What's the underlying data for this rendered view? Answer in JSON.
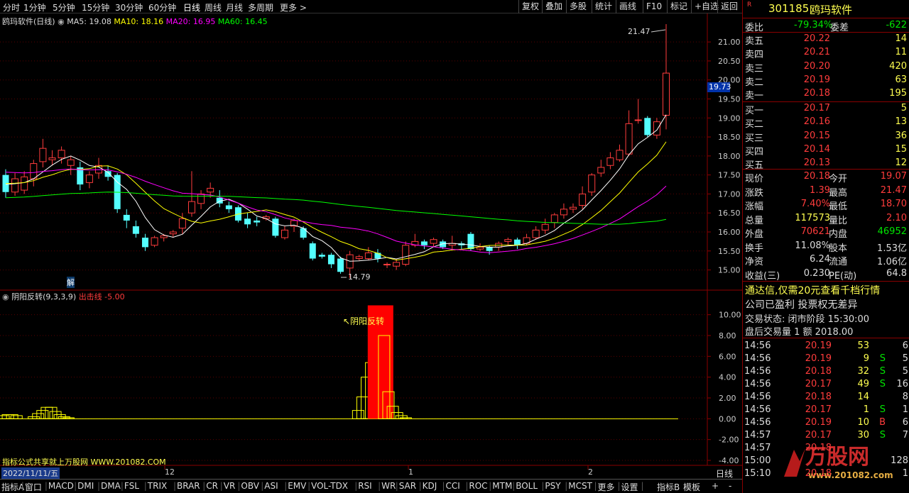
{
  "topbar": {
    "periods": [
      "分时",
      "1分钟",
      "5分钟",
      "15分钟",
      "30分钟",
      "60分钟",
      "日线",
      "周线",
      "月线",
      "多周期",
      "更多 >"
    ],
    "right_buttons": [
      "复权",
      "叠加",
      "多股",
      "统计",
      "画线",
      "F10",
      "标记",
      "+自选",
      "返回"
    ]
  },
  "main_legend": {
    "title": "鸥玛软件(日线)",
    "ma5": "MA5: 19.08",
    "ma10": "MA10: 18.16",
    "ma20": "MA20: 16.95",
    "ma60": "MA60: 16.45"
  },
  "price_axis": {
    "ticks": [
      "21.00",
      "20.50",
      "20.00",
      "19.50",
      "19.00",
      "18.50",
      "18.00",
      "17.50",
      "17.00",
      "16.50",
      "16.00",
      "15.50",
      "15.00"
    ],
    "current": "19.73"
  },
  "annotations": {
    "high": "21.47",
    "low": "14.79",
    "jie": "解"
  },
  "indicator": {
    "title": "阴阳反转(9,3,3,9)",
    "signal": "出击线  -5.00",
    "label": "阴阳反转",
    "ticks": [
      "10.00",
      "8.00",
      "6.00",
      "4.00",
      "2.00",
      "0.00",
      "-2.00",
      "-4.00"
    ],
    "watermark": "指标公式共享就上万股网 WWW.201082.COM"
  },
  "date_axis": {
    "date": "2022/11/11/五",
    "labels": [
      "12",
      "1",
      "2"
    ],
    "period": "日线"
  },
  "bottombar": {
    "tabs": [
      "指标A",
      "窗口",
      "MACD",
      "DMI",
      "DMA",
      "FSL",
      "TRIX",
      "BRAR",
      "CR",
      "VR",
      "OBV",
      "ASI",
      "EMV",
      "VOL-TDX",
      "RSI",
      "WR",
      "SAR",
      "KDJ",
      "CCI",
      "ROC",
      "MTM",
      "BOLL",
      "PSY",
      "MCST",
      "更多",
      "设置"
    ],
    "right": [
      "指标B",
      "模板",
      "+",
      "-"
    ]
  },
  "stock": {
    "code": "301185",
    "name": "鸥玛软件",
    "badge": "R"
  },
  "order_book": {
    "weibi_label": "委比",
    "weibi": "-79.34%",
    "weicha_label": "委差",
    "weicha": "-622",
    "sell": [
      {
        "label": "卖五",
        "price": "20.22",
        "vol": "14"
      },
      {
        "label": "卖四",
        "price": "20.21",
        "vol": "11"
      },
      {
        "label": "卖三",
        "price": "20.20",
        "vol": "420"
      },
      {
        "label": "卖二",
        "price": "20.19",
        "vol": "63"
      },
      {
        "label": "卖一",
        "price": "20.18",
        "vol": "195"
      }
    ],
    "buy": [
      {
        "label": "买一",
        "price": "20.17",
        "vol": "5"
      },
      {
        "label": "买二",
        "price": "20.16",
        "vol": "13"
      },
      {
        "label": "买三",
        "price": "20.15",
        "vol": "36"
      },
      {
        "label": "买四",
        "price": "20.14",
        "vol": "15"
      },
      {
        "label": "买五",
        "price": "20.13",
        "vol": "12"
      }
    ]
  },
  "quote": [
    {
      "l1": "现价",
      "v1": "20.18",
      "l2": "今开",
      "v2": "19.07"
    },
    {
      "l1": "涨跌",
      "v1": "1.39",
      "l2": "最高",
      "v2": "21.47"
    },
    {
      "l1": "涨幅",
      "v1": "7.40%",
      "l2": "最低",
      "v2": "18.70"
    },
    {
      "l1": "总量",
      "v1": "117573",
      "l2": "量比",
      "v2": "2.10"
    },
    {
      "l1": "外盘",
      "v1": "70621",
      "l2": "内盘",
      "v2": "46952"
    },
    {
      "l1": "换手",
      "v1": "11.08%",
      "l2": "股本",
      "v2": "1.53亿"
    },
    {
      "l1": "净资",
      "v1": "6.24",
      "l2": "流通",
      "v2": "1.06亿"
    },
    {
      "l1": "收益(三)",
      "v1": "0.230",
      "l2": "PE(动)",
      "v2": "64.8"
    }
  ],
  "ad1": "通达信,仅需20元查看千档行情",
  "ad2": "公司已盈利 投票权无差异",
  "status": "交易状态: 闭市阶段 15:30:00",
  "after": "盘后交易量 1 额 2018.00",
  "ticks": [
    {
      "t": "14:56",
      "p": "20.19",
      "v": "53",
      "f": "",
      "n": "6"
    },
    {
      "t": "14:56",
      "p": "20.19",
      "v": "9",
      "f": "S",
      "n": "5"
    },
    {
      "t": "14:56",
      "p": "20.18",
      "v": "32",
      "f": "S",
      "n": "5"
    },
    {
      "t": "14:56",
      "p": "20.17",
      "v": "49",
      "f": "S",
      "n": "16"
    },
    {
      "t": "14:56",
      "p": "20.18",
      "v": "14",
      "f": "",
      "n": "8"
    },
    {
      "t": "14:56",
      "p": "20.17",
      "v": "1",
      "f": "S",
      "n": "1"
    },
    {
      "t": "14:56",
      "p": "20.19",
      "v": "10",
      "f": "B",
      "n": "6"
    },
    {
      "t": "14:57",
      "p": "20.17",
      "v": "30",
      "f": "S",
      "n": "7"
    },
    {
      "t": "14:57",
      "p": "20.18",
      "v": "",
      "f": "",
      "n": ""
    },
    {
      "t": "15:00",
      "p": "",
      "v": "",
      "f": "",
      "n": "128"
    },
    {
      "t": "15:10",
      "p": "20.18",
      "v": "",
      "f": "",
      "n": "1"
    }
  ],
  "logo": {
    "name": "万股网",
    "url": "www.201082.com"
  },
  "chart_data": {
    "type": "candlestick",
    "candles": [
      [
        17.5,
        17.05,
        17.65,
        16.9
      ],
      [
        17.05,
        17.4,
        17.55,
        16.95
      ],
      [
        17.1,
        17.45,
        17.6,
        17.0
      ],
      [
        17.4,
        17.8,
        17.9,
        17.2
      ],
      [
        17.85,
        18.2,
        18.45,
        17.7
      ],
      [
        17.9,
        17.95,
        18.15,
        17.75
      ],
      [
        17.95,
        18.15,
        18.25,
        17.8
      ],
      [
        17.75,
        17.9,
        18.0,
        17.5
      ],
      [
        17.7,
        17.25,
        17.85,
        17.1
      ],
      [
        17.3,
        17.5,
        17.6,
        17.15
      ],
      [
        17.55,
        17.75,
        17.95,
        17.4
      ],
      [
        17.6,
        17.45,
        17.75,
        17.35
      ],
      [
        17.5,
        16.6,
        17.55,
        16.5
      ],
      [
        16.45,
        16.3,
        16.6,
        16.1
      ],
      [
        16.15,
        15.95,
        16.3,
        15.85
      ],
      [
        15.85,
        15.6,
        15.95,
        15.5
      ],
      [
        15.65,
        15.85,
        15.9,
        15.6
      ],
      [
        15.85,
        15.9,
        15.95,
        15.75
      ],
      [
        15.95,
        16.0,
        16.05,
        15.85
      ],
      [
        16.1,
        16.35,
        16.5,
        15.95
      ],
      [
        16.5,
        16.8,
        17.6,
        16.4
      ],
      [
        16.75,
        17.0,
        17.1,
        16.6
      ],
      [
        17.05,
        17.15,
        17.3,
        16.9
      ],
      [
        16.9,
        16.75,
        17.1,
        16.65
      ],
      [
        16.7,
        16.6,
        16.8,
        16.5
      ],
      [
        16.65,
        16.3,
        16.7,
        16.25
      ],
      [
        16.35,
        16.2,
        16.5,
        16.1
      ],
      [
        16.3,
        16.25,
        16.4,
        16.15
      ],
      [
        16.35,
        16.4,
        16.45,
        16.3
      ],
      [
        16.35,
        15.9,
        16.4,
        15.85
      ],
      [
        15.85,
        16.05,
        16.15,
        15.8
      ],
      [
        16.15,
        16.3,
        16.35,
        16.0
      ],
      [
        16.1,
        15.85,
        16.15,
        15.8
      ],
      [
        15.7,
        15.3,
        15.75,
        15.25
      ],
      [
        15.4,
        15.35,
        15.45,
        15.3
      ],
      [
        15.4,
        15.15,
        15.45,
        15.05
      ],
      [
        15.3,
        14.95,
        15.35,
        14.9
      ],
      [
        15.05,
        15.4,
        15.5,
        14.79
      ],
      [
        15.3,
        15.35,
        15.4,
        15.25
      ],
      [
        15.3,
        15.45,
        15.6,
        15.25
      ],
      [
        15.45,
        15.3,
        15.55,
        15.2
      ],
      [
        15.15,
        15.15,
        15.2,
        15.05
      ],
      [
        15.1,
        15.2,
        15.3,
        15.0
      ],
      [
        15.15,
        15.65,
        15.75,
        15.1
      ],
      [
        15.65,
        15.75,
        15.95,
        15.6
      ],
      [
        15.75,
        15.65,
        15.8,
        15.55
      ],
      [
        15.7,
        15.8,
        15.85,
        15.6
      ],
      [
        15.75,
        15.6,
        15.8,
        15.55
      ],
      [
        15.65,
        15.7,
        15.9,
        15.55
      ],
      [
        15.7,
        15.65,
        15.75,
        15.55
      ],
      [
        15.95,
        15.55,
        16.0,
        15.5
      ],
      [
        15.55,
        15.6,
        15.7,
        15.5
      ],
      [
        15.6,
        15.5,
        15.65,
        15.4
      ],
      [
        15.6,
        15.7,
        15.75,
        15.5
      ],
      [
        15.75,
        15.8,
        15.85,
        15.65
      ],
      [
        15.8,
        15.65,
        15.85,
        15.55
      ],
      [
        15.7,
        15.85,
        15.95,
        15.65
      ],
      [
        15.85,
        16.05,
        16.15,
        15.8
      ],
      [
        16.05,
        16.2,
        16.35,
        15.95
      ],
      [
        16.25,
        16.45,
        16.5,
        16.1
      ],
      [
        16.45,
        16.6,
        16.75,
        16.35
      ],
      [
        16.6,
        16.65,
        16.75,
        16.5
      ],
      [
        16.7,
        17.0,
        17.2,
        16.6
      ],
      [
        17.05,
        17.5,
        17.55,
        16.95
      ],
      [
        17.55,
        17.7,
        17.9,
        17.45
      ],
      [
        17.75,
        17.95,
        18.1,
        17.65
      ],
      [
        17.9,
        18.15,
        18.3,
        17.85
      ],
      [
        18.05,
        18.85,
        19.2,
        18.0
      ],
      [
        18.95,
        18.95,
        19.5,
        18.85
      ],
      [
        19.0,
        18.55,
        19.05,
        18.5
      ],
      [
        18.55,
        18.9,
        19.0,
        18.45
      ],
      [
        19.07,
        20.18,
        21.47,
        18.7
      ]
    ],
    "indicator_values": [
      0.3,
      0.4,
      0.4,
      0.3,
      0,
      0,
      0,
      0.2,
      0.5,
      0.8,
      1.1,
      1.1,
      0.7,
      0.4,
      0.2,
      0.1,
      0,
      0,
      0,
      0,
      0,
      0,
      0,
      0,
      0,
      0,
      0,
      0,
      0,
      0,
      0,
      0,
      0,
      0,
      0,
      0,
      0,
      0,
      0,
      0,
      0,
      0,
      0,
      0,
      0,
      0,
      0,
      0,
      0,
      0,
      0,
      0,
      0,
      0,
      0,
      0,
      0,
      0,
      0,
      0,
      0,
      0,
      0,
      0,
      0,
      0,
      0,
      0,
      0,
      0,
      0,
      0,
      0,
      0,
      0,
      0,
      0,
      0,
      0,
      0,
      0,
      0,
      0.8,
      2.1,
      4.0,
      5.4,
      7.9,
      10.9,
      8.0,
      2.6,
      1.2,
      0.6,
      0.3,
      0.1,
      0,
      0,
      0,
      0,
      0,
      0,
      0,
      0,
      0,
      0,
      0,
      0,
      0,
      0,
      0,
      0,
      0,
      0,
      0,
      0,
      0,
      0,
      0,
      0,
      0,
      0,
      0,
      0,
      0,
      0,
      0,
      0,
      0,
      0,
      0,
      0,
      0,
      0,
      0,
      0,
      0,
      0,
      0,
      0,
      0,
      0,
      0,
      0,
      0,
      0,
      0,
      0,
      0,
      0,
      0,
      0,
      0,
      0,
      0,
      0,
      0,
      0,
      0
    ],
    "indicator_ylim": [
      -4,
      11
    ],
    "price_ylim": [
      14.6,
      21.6
    ]
  },
  "colors": {
    "up": "#ff3c3c",
    "down": "#54ffff",
    "ma5": "#ffffff",
    "ma10": "#ffff00",
    "ma20": "#ff00ff",
    "ma60": "#00ff00"
  }
}
